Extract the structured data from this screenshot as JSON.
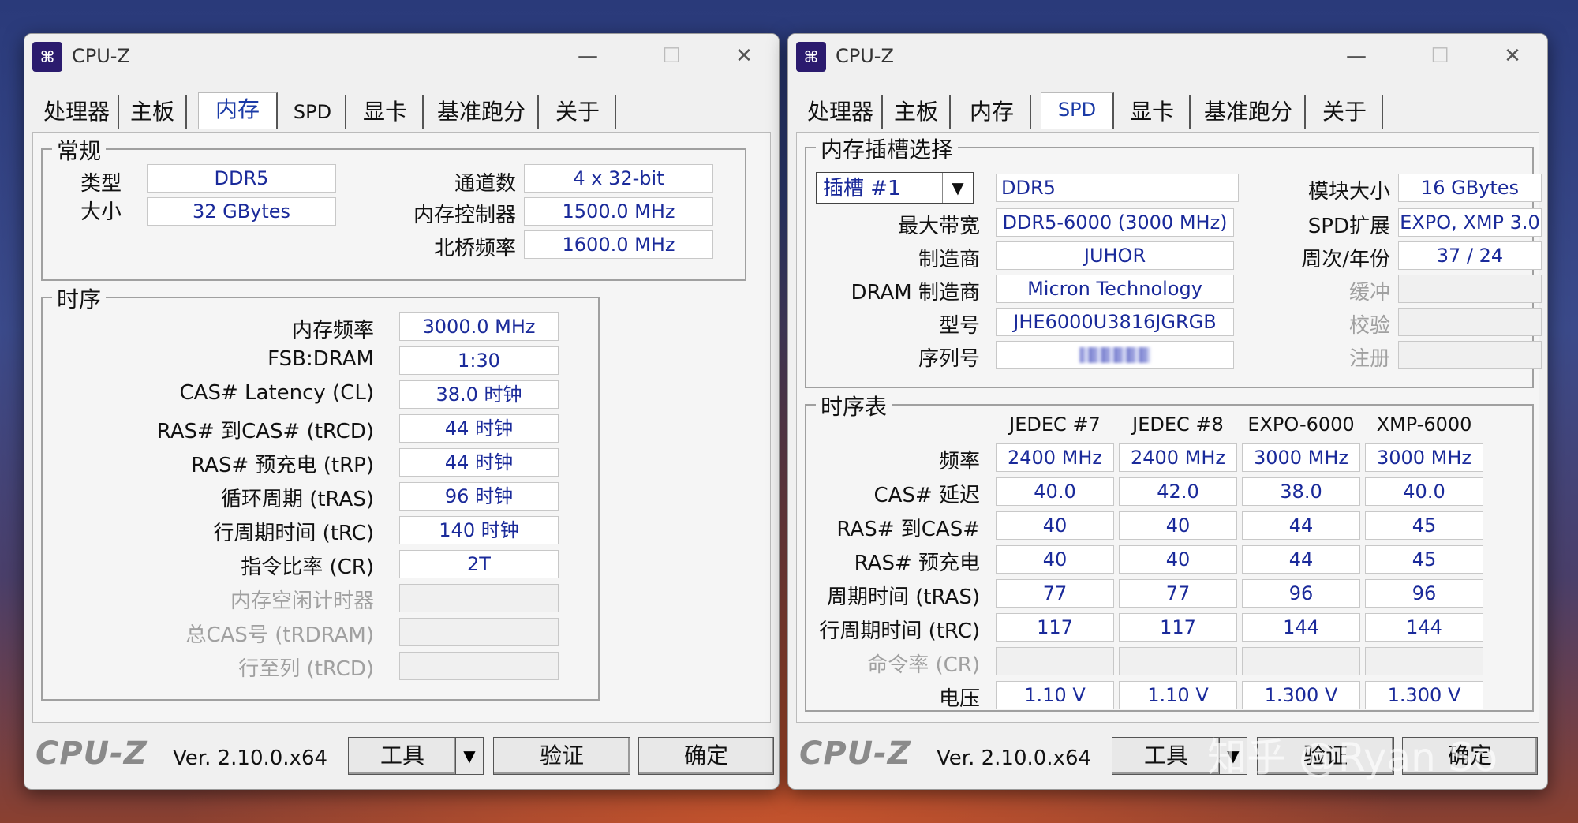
{
  "left": {
    "title": "CPU-Z",
    "tabs": [
      "处理器",
      "主板",
      "内存",
      "SPD",
      "显卡",
      "基准跑分",
      "关于"
    ],
    "general": {
      "title": "常规",
      "type_label": "类型",
      "type_value": "DDR5",
      "size_label": "大小",
      "size_value": "32 GBytes",
      "channels_label": "通道数",
      "channels_value": "4 x 32-bit",
      "mc_label": "内存控制器",
      "mc_value": "1500.0 MHz",
      "nb_label": "北桥频率",
      "nb_value": "1600.0 MHz"
    },
    "timings": {
      "title": "时序",
      "rows": [
        {
          "label": "内存频率",
          "value": "3000.0 MHz"
        },
        {
          "label": "FSB:DRAM",
          "value": "1:30"
        },
        {
          "label": "CAS# Latency (CL)",
          "value": "38.0 时钟"
        },
        {
          "label": "RAS# 到CAS# (tRCD)",
          "value": "44 时钟"
        },
        {
          "label": "RAS# 预充电 (tRP)",
          "value": "44 时钟"
        },
        {
          "label": "循环周期 (tRAS)",
          "value": "96 时钟"
        },
        {
          "label": "行周期时间 (tRC)",
          "value": "140 时钟"
        },
        {
          "label": "指令比率 (CR)",
          "value": "2T"
        },
        {
          "label": "内存空闲计时器",
          "value": ""
        },
        {
          "label": "总CAS号 (tRDRAM)",
          "value": ""
        },
        {
          "label": "行至列 (tRCD)",
          "value": ""
        }
      ]
    },
    "footer": {
      "logo": "CPU-Z",
      "version": "Ver. 2.10.0.x64",
      "tools": "工具",
      "validate": "验证",
      "ok": "确定"
    }
  },
  "right": {
    "title": "CPU-Z",
    "tabs": [
      "处理器",
      "主板",
      "内存",
      "SPD",
      "显卡",
      "基准跑分",
      "关于"
    ],
    "slot": {
      "title": "内存插槽选择",
      "slot_select": "插槽 #1",
      "type_value": "DDR5",
      "module_size_label": "模块大小",
      "module_size_value": "16 GBytes",
      "max_bw_label": "最大带宽",
      "max_bw_value": "DDR5-6000 (3000 MHz)",
      "spd_ext_label": "SPD扩展",
      "spd_ext_value": "EXPO, XMP 3.0",
      "mfr_label": "制造商",
      "mfr_value": "JUHOR",
      "week_year_label": "周次/年份",
      "week_year_value": "37 / 24",
      "dram_mfr_label": "DRAM 制造商",
      "dram_mfr_value": "Micron Technology",
      "buffered_label": "缓冲",
      "part_label": "型号",
      "part_value": "JHE6000U3816JGRGB",
      "correction_label": "校验",
      "serial_label": "序列号",
      "registered_label": "注册"
    },
    "timing_table": {
      "title": "时序表",
      "columns": [
        "JEDEC #7",
        "JEDEC #8",
        "EXPO-6000",
        "XMP-6000"
      ],
      "rows": [
        {
          "label": "频率",
          "values": [
            "2400 MHz",
            "2400 MHz",
            "3000 MHz",
            "3000 MHz"
          ]
        },
        {
          "label": "CAS# 延迟",
          "values": [
            "40.0",
            "42.0",
            "38.0",
            "40.0"
          ]
        },
        {
          "label": "RAS# 到CAS#",
          "values": [
            "40",
            "40",
            "44",
            "45"
          ]
        },
        {
          "label": "RAS# 预充电",
          "values": [
            "40",
            "40",
            "44",
            "45"
          ]
        },
        {
          "label": "周期时间 (tRAS)",
          "values": [
            "77",
            "77",
            "96",
            "96"
          ]
        },
        {
          "label": "行周期时间 (tRC)",
          "values": [
            "117",
            "117",
            "144",
            "144"
          ]
        },
        {
          "label": "命令率 (CR)",
          "values": [
            "",
            "",
            "",
            ""
          ]
        },
        {
          "label": "电压",
          "values": [
            "1.10 V",
            "1.10 V",
            "1.300 V",
            "1.300 V"
          ]
        }
      ]
    },
    "footer": {
      "logo": "CPU-Z",
      "version": "Ver. 2.10.0.x64",
      "tools": "工具",
      "validate": "验证",
      "ok": "确定"
    }
  },
  "watermark": "知乎 @Ryan So"
}
